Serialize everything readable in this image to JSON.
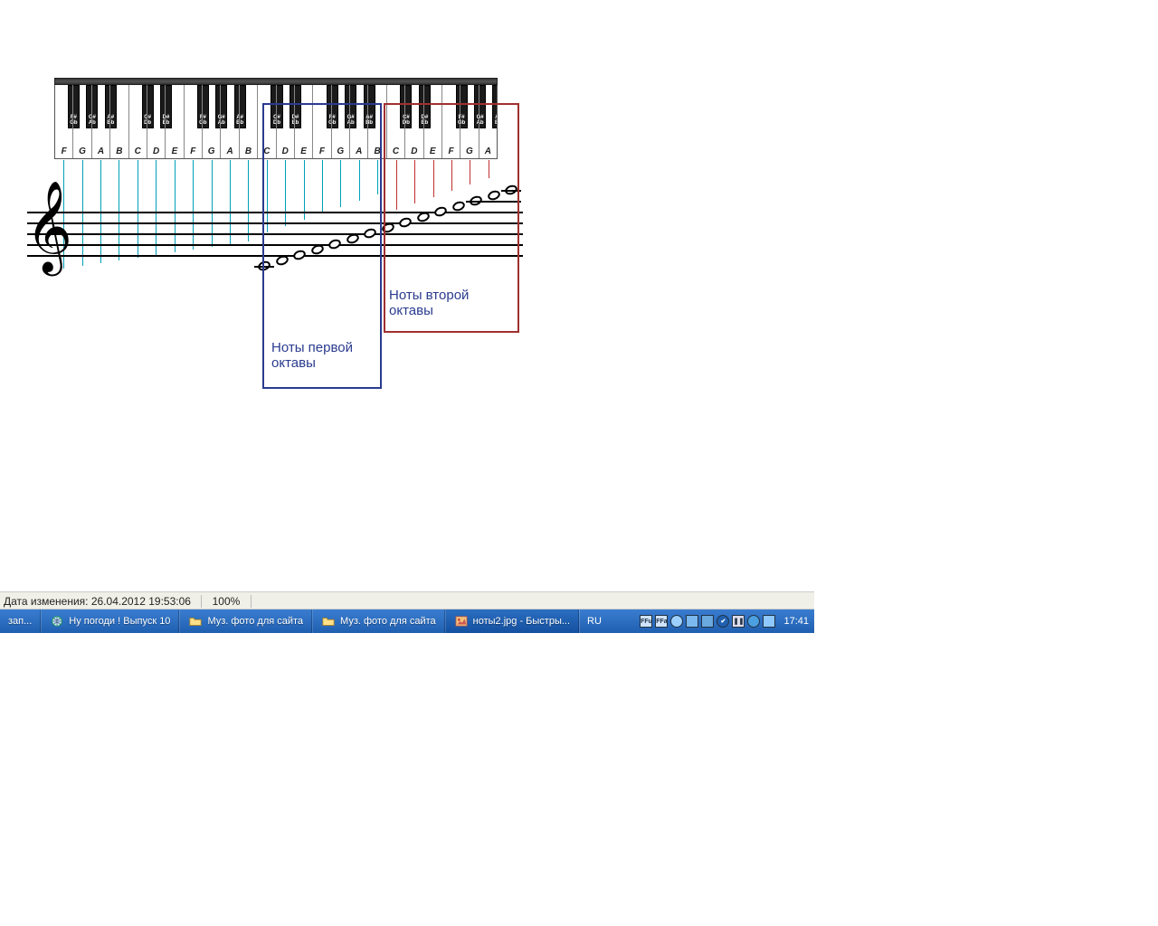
{
  "statusbar": {
    "modified_label": "Дата изменения: 26.04.2012 19:53:06",
    "zoom": "100%"
  },
  "taskbar": {
    "items": [
      {
        "label": "зап..."
      },
      {
        "label": "Ну погоди ! Выпуск 10"
      },
      {
        "label": "Муз. фото для сайта"
      },
      {
        "label": "Муз. фото для сайта"
      },
      {
        "label": "ноты2.jpg - Быстры..."
      }
    ],
    "lang": "RU",
    "clock": "17:41",
    "tray_icons": [
      "FFu",
      "FFa",
      "net",
      "net",
      "mon",
      "av",
      "pause",
      "disk",
      "rc"
    ]
  },
  "diagram": {
    "white_keys": [
      "F",
      "G",
      "A",
      "B",
      "C",
      "D",
      "E",
      "F",
      "G",
      "A",
      "B",
      "C",
      "D",
      "E",
      "F",
      "G",
      "A",
      "B",
      "C",
      "D",
      "E",
      "F",
      "G",
      "A"
    ],
    "black_keys": [
      {
        "pos": 0,
        "top": "F#",
        "bot": "Gb"
      },
      {
        "pos": 1,
        "top": "G#",
        "bot": "Ab"
      },
      {
        "pos": 2,
        "top": "A#",
        "bot": "Bb"
      },
      {
        "pos": 4,
        "top": "C#",
        "bot": "Db"
      },
      {
        "pos": 5,
        "top": "D#",
        "bot": "Eb"
      },
      {
        "pos": 7,
        "top": "F#",
        "bot": "Gb"
      },
      {
        "pos": 8,
        "top": "G#",
        "bot": "Ab"
      },
      {
        "pos": 9,
        "top": "A#",
        "bot": "Bb"
      },
      {
        "pos": 11,
        "top": "C#",
        "bot": "Db"
      },
      {
        "pos": 12,
        "top": "D#",
        "bot": "Eb"
      },
      {
        "pos": 14,
        "top": "F#",
        "bot": "Gb"
      },
      {
        "pos": 15,
        "top": "G#",
        "bot": "Ab"
      },
      {
        "pos": 16,
        "top": "A#",
        "bot": "Bb"
      },
      {
        "pos": 18,
        "top": "C#",
        "bot": "Db"
      },
      {
        "pos": 19,
        "top": "D#",
        "bot": "Eb"
      },
      {
        "pos": 21,
        "top": "F#",
        "bot": "Gb"
      },
      {
        "pos": 22,
        "top": "G#",
        "bot": "Ab"
      },
      {
        "pos": 23,
        "top": "A#",
        "bot": "Bb"
      }
    ],
    "scale_notes": [
      "C4",
      "D4",
      "E4",
      "F4",
      "G4",
      "A4",
      "B4",
      "C5",
      "D5",
      "E5",
      "F5",
      "G5",
      "A5",
      "B5",
      "C6"
    ],
    "box1_label": "Ноты первой октавы",
    "box2_label": "Ноты второй октавы"
  }
}
